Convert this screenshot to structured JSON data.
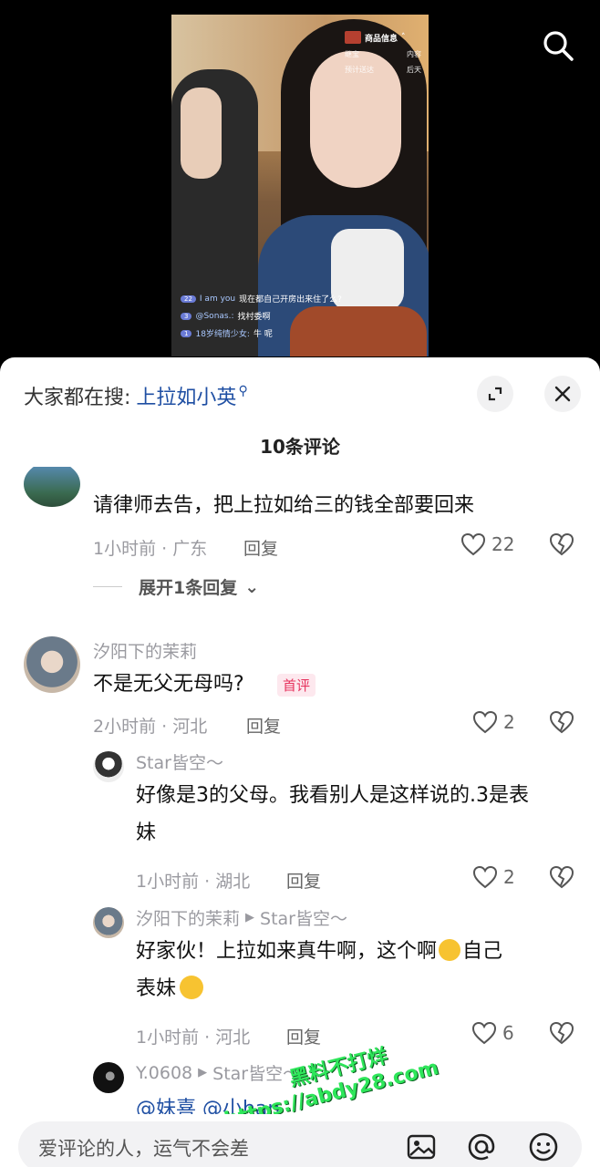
{
  "video": {
    "goods_label": "商品信息",
    "goods_row1_left": "继宝",
    "goods_row1_right": "内容",
    "goods_row2_left": "预计送达",
    "goods_row2_right": "后天",
    "live_comments": [
      {
        "level": "22",
        "user": "I am you",
        "text": "现在都自己开房出来住了么?"
      },
      {
        "level": "3",
        "user": "@Sonas.:",
        "text": "找村委啊"
      },
      {
        "level": "1",
        "user": "18岁纯情少女:",
        "text": "牛  呢"
      }
    ]
  },
  "sheet": {
    "hot_search_prefix": "大家都在搜:",
    "hot_search_keyword": "上拉如小英",
    "comment_count_title": "10条评论"
  },
  "comments": [
    {
      "text": "请律师去告，把上拉如给三的钱全部要回来",
      "meta": "1小时前 · 广东",
      "reply_label": "回复",
      "likes": "22",
      "expand_label": "展开1条回复"
    },
    {
      "name": "汐阳下的茉莉",
      "text": "不是无父无母吗?",
      "badge": "首评",
      "meta": "2小时前 · 河北",
      "reply_label": "回复",
      "likes": "2"
    }
  ],
  "replies": [
    {
      "name": "Star皆空～",
      "text_line1": "好像是3的父母。我看别人是这样说的.3是表",
      "text_line2": "妹",
      "meta": "1小时前 · 湖北",
      "reply_label": "回复",
      "likes": "2"
    },
    {
      "name": "汐阳下的茉莉",
      "reply_to": "Star皆空～",
      "text_line1": "好家伙！上拉如来真牛啊，这个啊",
      "text_line1_tail": "自己",
      "text_line2": "表妹",
      "meta": "1小时前 · 河北",
      "reply_label": "回复",
      "likes": "6"
    },
    {
      "name": "Y.0608",
      "reply_to": "Star皆空～",
      "text_line1": "@妹喜  @小han"
    }
  ],
  "watermark": {
    "line1": "黑料不打烊",
    "line2": "https://abdy28.com"
  },
  "input": {
    "placeholder": "爱评论的人，运气不会差"
  }
}
